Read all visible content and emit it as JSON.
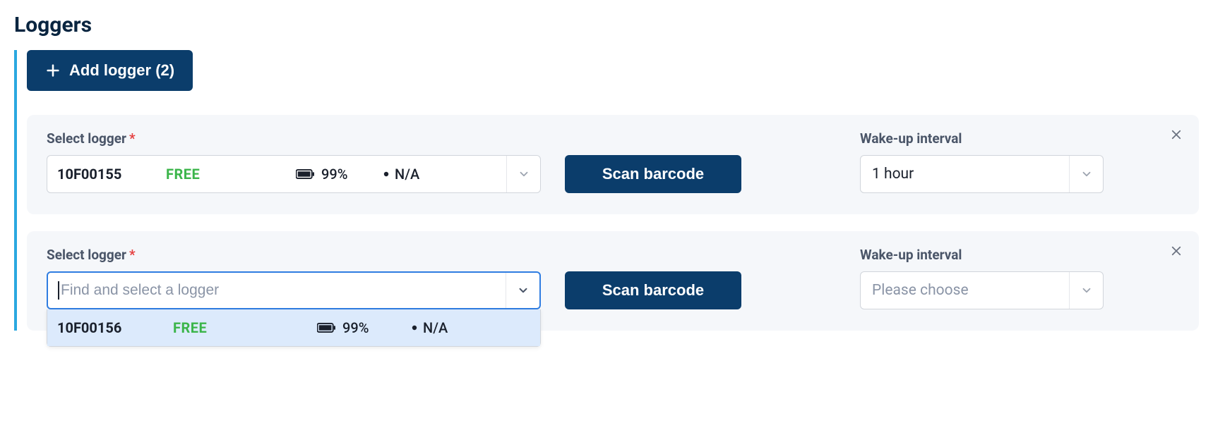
{
  "title": "Loggers",
  "add_button_label": "Add logger (2)",
  "labels": {
    "select_logger": "Select logger",
    "wake_up_interval": "Wake-up interval",
    "scan_barcode": "Scan barcode",
    "required_mark": "*"
  },
  "search_placeholder": "Find and select a logger",
  "wake_placeholder": "Please choose",
  "loggers": [
    {
      "selected": {
        "id": "10F00155",
        "status": "FREE",
        "battery": "99%",
        "signal": "N/A"
      },
      "wake": "1 hour"
    },
    {
      "selected": null,
      "wake": null
    }
  ],
  "dropdown_option": {
    "id": "10F00156",
    "status": "FREE",
    "battery": "99%",
    "signal": "N/A"
  }
}
